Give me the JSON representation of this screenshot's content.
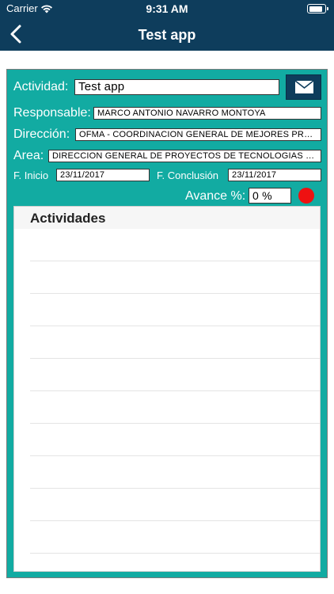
{
  "status": {
    "carrier": "Carrier",
    "time": "9:31 AM",
    "battery_level": 0.9
  },
  "nav": {
    "title": "Test app",
    "back_icon": "chevron-left-icon"
  },
  "form": {
    "actividad": {
      "label": "Actividad:",
      "value": "Test app"
    },
    "responsable": {
      "label": "Responsable:",
      "value": "MARCO ANTONIO NAVARRO MONTOYA"
    },
    "direccion": {
      "label": "Dirección:",
      "value": "OFMA - COORDINACION GENERAL DE MEJORES PRACTICAS"
    },
    "area": {
      "label": "Area:",
      "value": "DIRECCION GENERAL DE PROYECTOS DE TECNOLOGIAS DE LA INFORMACION"
    },
    "inicio": {
      "label": "F. Inicio",
      "value": "23/11/2017"
    },
    "conclusion": {
      "label": "F. Conclusión",
      "value": "23/11/2017"
    },
    "avance": {
      "label": "Avance %:",
      "value": "0 %"
    },
    "status_color": "#ee1111",
    "mail_icon": "envelope-icon"
  },
  "activities": {
    "title": "Actividades",
    "rows": 10
  },
  "colors": {
    "navbar": "#0e3d5c",
    "panel": "#12aba2",
    "status_dot": "#ee1111"
  }
}
